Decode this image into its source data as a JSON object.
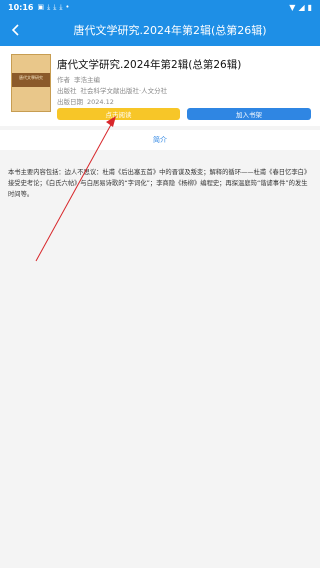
{
  "status_bar": {
    "time": "10:16",
    "icons": [
      "image-icon",
      "download-icon",
      "download-icon",
      "download-icon",
      "dot-icon"
    ],
    "right_icons": [
      "wifi-icon",
      "signal-icon",
      "battery-icon"
    ]
  },
  "appbar": {
    "title": "唐代文学研究.2024年第2辑(总第26辑)"
  },
  "book": {
    "title": "唐代文学研究.2024年第2辑(总第26辑)",
    "author_label": "作者",
    "author": "李浩主编",
    "publisher_label": "出版社",
    "publisher": "社会科学文献出版社·人文分社",
    "date_label": "出版日期",
    "date": "2024.12",
    "cover_text": "唐代文學研究"
  },
  "buttons": {
    "read": "点击阅读",
    "shelf": "加入书架"
  },
  "tabs": {
    "intro": "简介"
  },
  "description": "本书主要内容包括：边人不思议：杜甫《后出塞五首》中的晋谋及叛变；解释的循环——杜甫《春日忆李白》接受史考论；《白氏六帖》与白居易诗歌的“字词化”；李商隐《杨柳》编程史；再探温庭筠“谐谑事件”的发生时间等。",
  "colors": {
    "primary": "#1e8fe6",
    "read_button": "#f7c628",
    "shelf_button": "#2f86e3",
    "arrow": "#d8262a"
  }
}
